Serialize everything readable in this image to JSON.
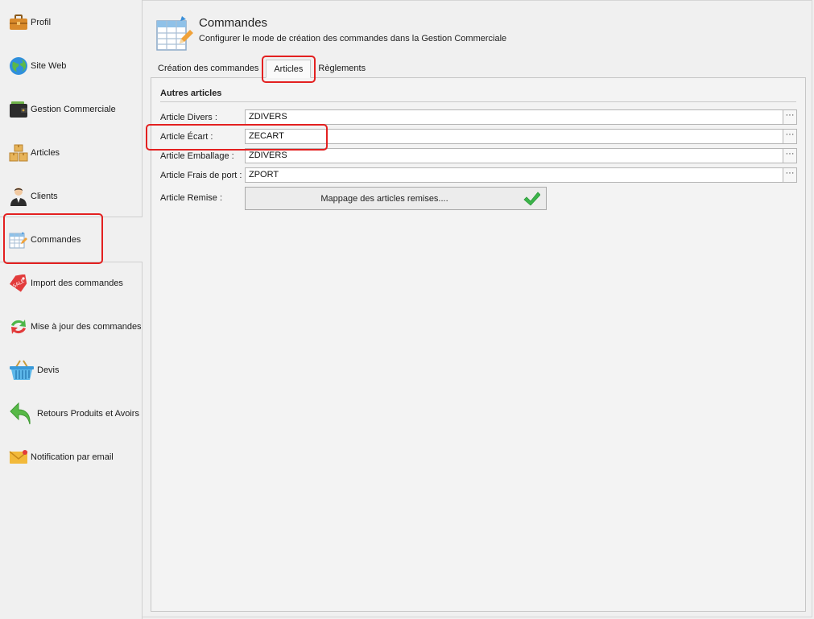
{
  "sidebar": {
    "items": [
      {
        "label": "Profil",
        "icon": "briefcase-icon"
      },
      {
        "label": "Site Web",
        "icon": "globe-icon"
      },
      {
        "label": "Gestion Commerciale",
        "icon": "wallet-icon"
      },
      {
        "label": "Articles",
        "icon": "boxes-icon"
      },
      {
        "label": "Clients",
        "icon": "user-icon"
      },
      {
        "label": "Commandes",
        "icon": "spreadsheet-icon",
        "selected": true
      },
      {
        "label": "Import des commandes",
        "icon": "sale-tag-icon"
      },
      {
        "label": "Mise à jour des commandes",
        "icon": "refresh-arrows-icon"
      },
      {
        "label": "Devis",
        "icon": "basket-icon"
      },
      {
        "label": "Retours Produits et Avoirs",
        "icon": "return-arrow-icon"
      },
      {
        "label": "Notification par email",
        "icon": "envelope-icon"
      }
    ]
  },
  "header": {
    "title": "Commandes",
    "subtitle": "Configurer le mode de création des commandes dans la Gestion Commerciale"
  },
  "tabs": [
    {
      "label": "Création des commandes"
    },
    {
      "label": "Articles",
      "active": true
    },
    {
      "label": "Règlements"
    }
  ],
  "group": {
    "title": "Autres articles",
    "rows": [
      {
        "label": "Article Divers :",
        "value": "ZDIVERS"
      },
      {
        "label": "Article Écart :",
        "value": "ZECART"
      },
      {
        "label": "Article Emballage :",
        "value": "ZDIVERS"
      },
      {
        "label": "Article Frais de port :",
        "value": "ZPORT"
      }
    ],
    "remise": {
      "label": "Article Remise :",
      "button_label": "Mappage des articles remises....",
      "status_icon": "checkmark-icon",
      "status_color": "#3cb44a"
    }
  },
  "browse_label": "···",
  "highlight_color": "#e32020"
}
